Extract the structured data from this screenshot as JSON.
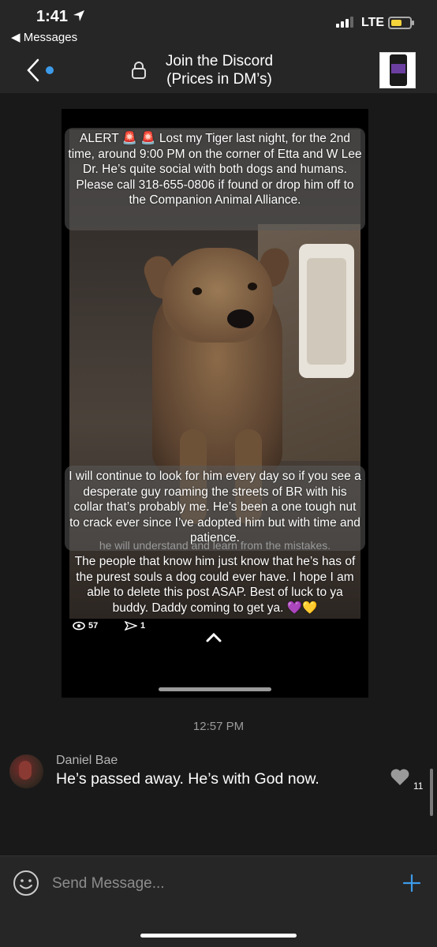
{
  "status_bar": {
    "time": "1:41",
    "back_app": "◀ Messages",
    "network": "LTE",
    "battery_level": 0.6,
    "battery_color": "#f5d33a"
  },
  "header": {
    "title_line1": "Join the Discord",
    "title_line2": "(Prices in DM’s)",
    "unread_dot_color": "#3d9be9"
  },
  "story": {
    "caption_top": "ALERT 🚨 🚨 Lost my Tiger last night, for the 2nd time, around 9:00 PM on the corner of Etta and W Lee Dr. He’s quite social with both dogs and humans. Please call 318-655-0806 if found or drop him off to the Companion Animal Alliance.",
    "caption_mid": "I will continue to look for him every day so if you see a desperate guy roaming the streets of BR with his collar that’s probably me. He’s been a one tough nut to crack ever since I’ve adopted him but with time and patience.",
    "caption_ghost": "he will understand and learn from the mistakes.",
    "caption_bottom": "The people that know him just know that he’s has of the purest souls a dog could ever have. I hope I am able to delete this post ASAP. Best of luck to ya buddy. Daddy coming to get ya. 💜💛",
    "views": "57",
    "shares": "1"
  },
  "timestamp": "12:57 PM",
  "message": {
    "sender": "Daniel Bae",
    "text": "He’s passed away. He’s with God now.",
    "likes": "11"
  },
  "input": {
    "placeholder": "Send Message..."
  },
  "accent_color": "#3d9be9"
}
